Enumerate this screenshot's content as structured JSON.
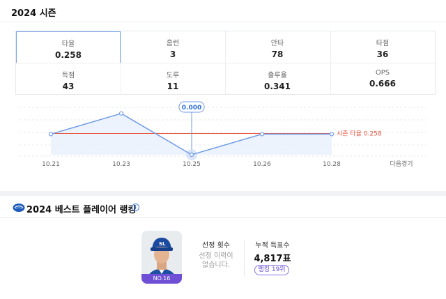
{
  "season": {
    "title": "2024 시즌",
    "stats": [
      {
        "label": "타율",
        "value": "0.258",
        "active": true
      },
      {
        "label": "홈런",
        "value": "3"
      },
      {
        "label": "안타",
        "value": "78"
      },
      {
        "label": "타점",
        "value": "36"
      },
      {
        "label": "득점",
        "value": "43"
      },
      {
        "label": "도루",
        "value": "11"
      },
      {
        "label": "출루율",
        "value": "0.341"
      },
      {
        "label": "OPS",
        "value": "0.666"
      }
    ]
  },
  "chart_data": {
    "type": "line",
    "categories": [
      "10.21",
      "10.23",
      "10.25",
      "10.26",
      "10.28"
    ],
    "series": [
      {
        "values": [
          0.25,
          0.5,
          0.0,
          0.25,
          0.25
        ],
        "color": "#6f9be6"
      }
    ],
    "reference_line": {
      "label": "시즌 타율 0.258",
      "value": 0.258,
      "color": "#e8553e"
    },
    "highlight": {
      "index": 2,
      "label": "0.000"
    },
    "next_label": "다음경기",
    "ylim": [
      0,
      0.6
    ],
    "grid": true
  },
  "ranking": {
    "title": "2024 베스트 플레이어 랭킹",
    "info_icon": "info-icon",
    "logo_icon": "team-logo-icon",
    "player_tag": "NO.16",
    "selection_label": "선정 횟수",
    "selection_text": "선정 이력이 없습니다.",
    "votes_label": "누적 득표수",
    "votes_value": "4,817표",
    "rank_badge": "랭킹 19위",
    "accent": "#6e4fd6"
  }
}
